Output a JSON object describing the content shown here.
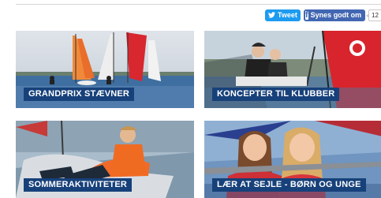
{
  "social": {
    "tweet_label": "Tweet",
    "like_label": "Synes godt om",
    "like_count": "12"
  },
  "tiles": [
    {
      "label": "GRANDPRIX STÆVNER"
    },
    {
      "label": "KONCEPTER TIL KLUBBER"
    },
    {
      "label": "SOMMERAKTIVITETER"
    },
    {
      "label": "LÆR AT SEJLE - BØRN OG UNGE"
    }
  ],
  "colors": {
    "label_bg": "#17417a",
    "tweet_bg": "#1d9bf0",
    "facebook_bg": "#4267b2"
  }
}
